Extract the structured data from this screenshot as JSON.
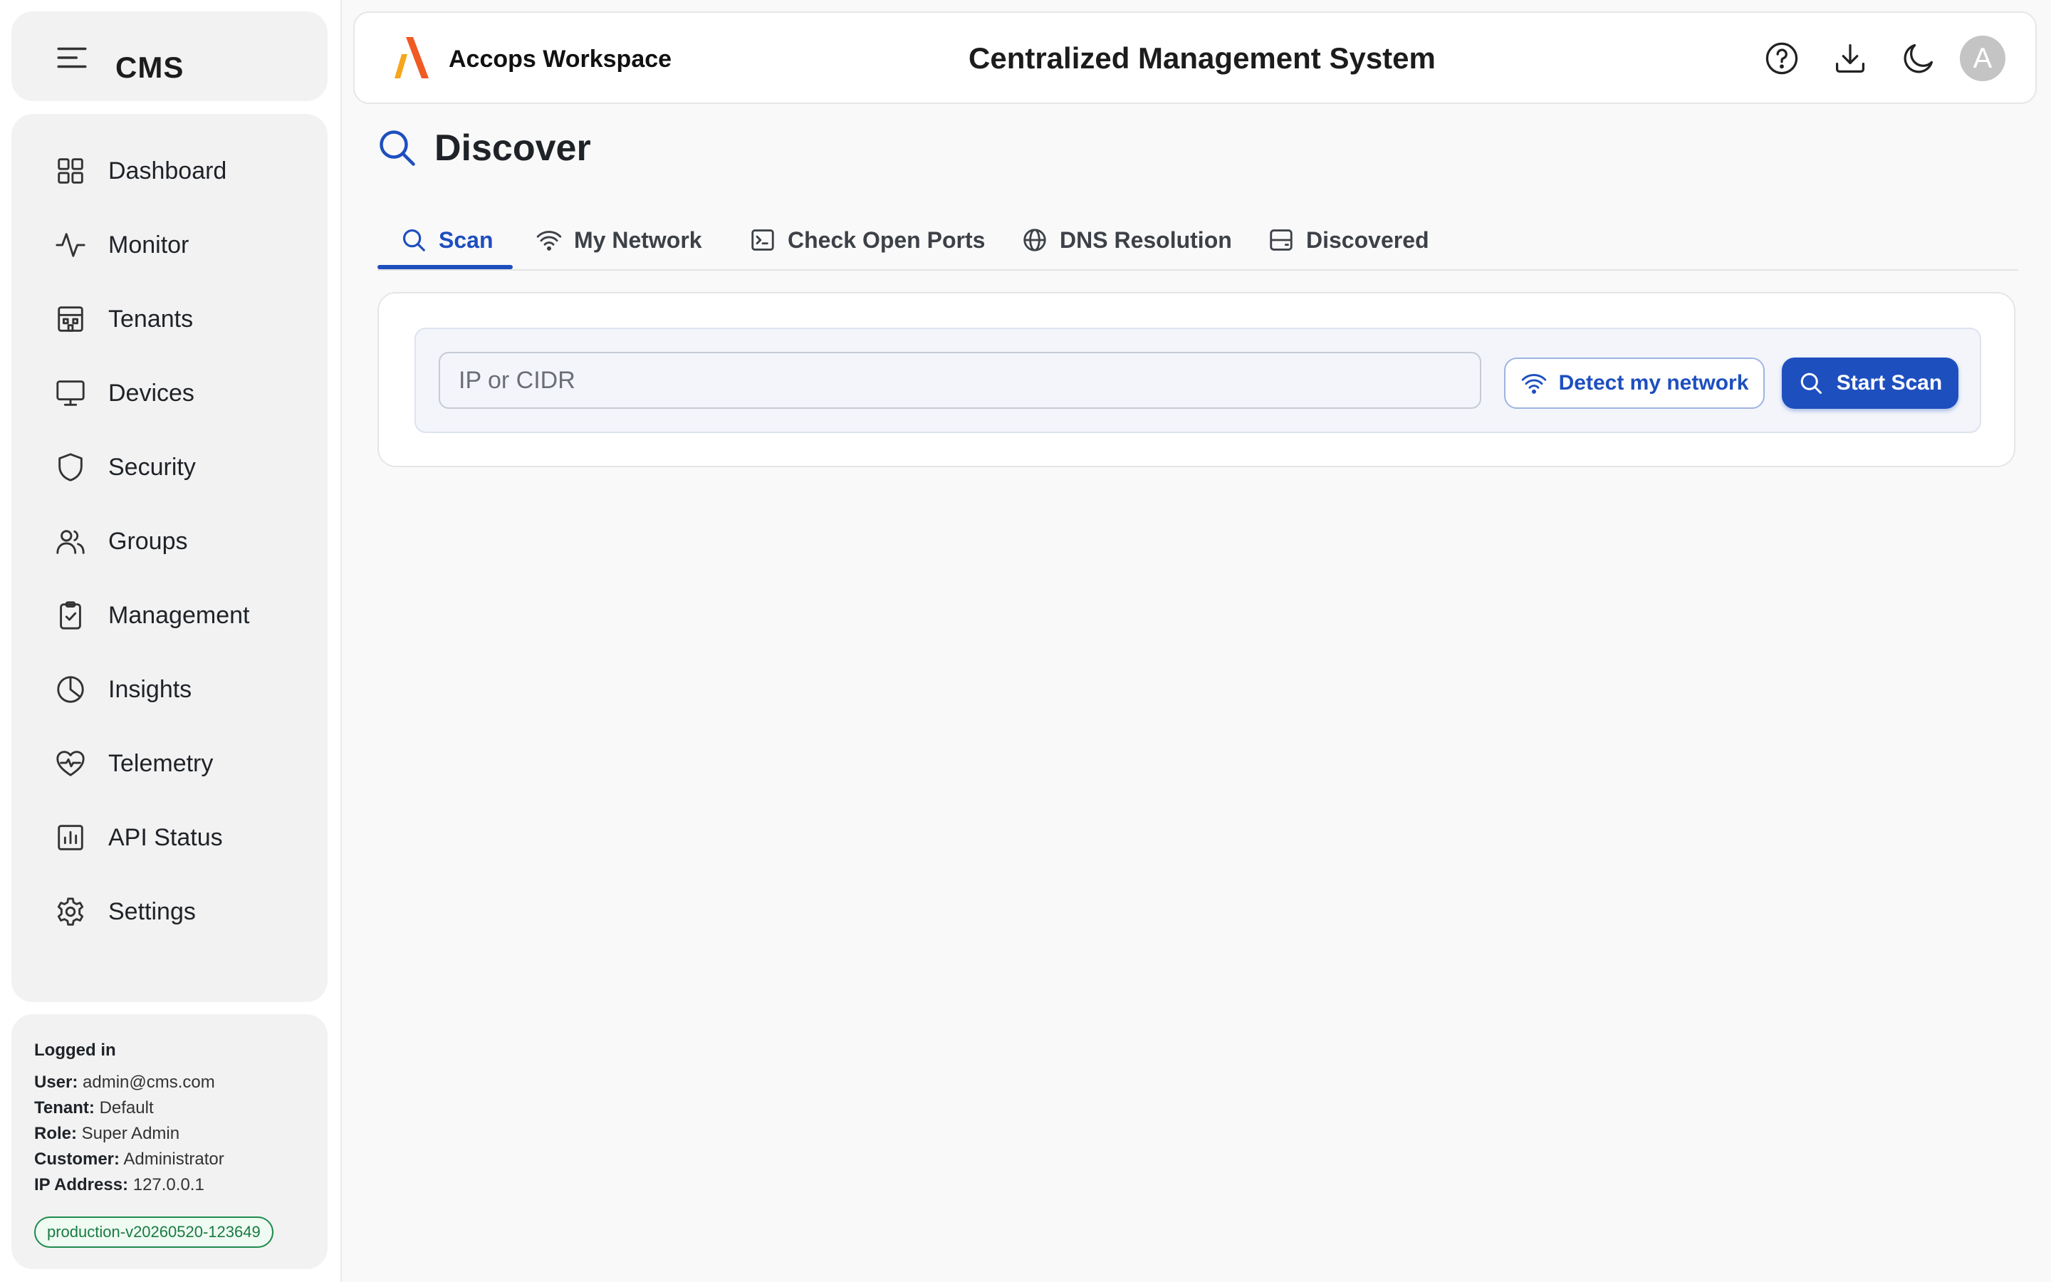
{
  "colors": {
    "accent": "#1e4fbf",
    "sidebar_card": "#f2f2f2",
    "page_background": "#f9f9f9",
    "badge_green": "#1f8a4c",
    "logo_orange": "#f05a24",
    "logo_amber": "#f7a51c"
  },
  "sidebar": {
    "brand": "CMS",
    "menu_icon": "hamburger-menu-icon",
    "items": [
      {
        "label": "Dashboard",
        "icon": "grid-icon"
      },
      {
        "label": "Monitor",
        "icon": "activity-icon"
      },
      {
        "label": "Tenants",
        "icon": "building-icon"
      },
      {
        "label": "Devices",
        "icon": "monitor-icon"
      },
      {
        "label": "Security",
        "icon": "shield-icon"
      },
      {
        "label": "Groups",
        "icon": "users-icon"
      },
      {
        "label": "Management",
        "icon": "clipboard-check-icon"
      },
      {
        "label": "Insights",
        "icon": "pie-chart-icon"
      },
      {
        "label": "Telemetry",
        "icon": "heart-pulse-icon"
      },
      {
        "label": "API Status",
        "icon": "bar-chart-icon"
      },
      {
        "label": "Settings",
        "icon": "gear-icon"
      }
    ],
    "session": {
      "title": "Logged in",
      "user_label": "User:",
      "user": "admin@cms.com",
      "tenant_label": "Tenant:",
      "tenant": "Default",
      "role_label": "Role:",
      "role": "Super Admin",
      "customer_label": "Customer:",
      "customer": "Administrator",
      "ip_label": "IP Address:",
      "ip": "127.0.0.1",
      "version": "production-v20260520-123649"
    }
  },
  "header": {
    "logo_text": "Accops Workspace",
    "title": "Centralized Management System",
    "icons": [
      "help-circle-icon",
      "download-icon",
      "moon-icon"
    ],
    "avatar_initial": "A"
  },
  "page": {
    "title": "Discover",
    "title_icon": "search-icon",
    "tabs": [
      {
        "label": "Scan",
        "icon": "search-icon",
        "active": true
      },
      {
        "label": "My Network",
        "icon": "wifi-icon",
        "active": false
      },
      {
        "label": "Check Open Ports",
        "icon": "terminal-icon",
        "active": false
      },
      {
        "label": "DNS Resolution",
        "icon": "globe-icon",
        "active": false
      },
      {
        "label": "Discovered",
        "icon": "server-icon",
        "active": false
      }
    ],
    "scan": {
      "input_placeholder": "IP or CIDR",
      "input_value": "",
      "detect_label": "Detect my network",
      "start_label": "Start Scan"
    }
  }
}
